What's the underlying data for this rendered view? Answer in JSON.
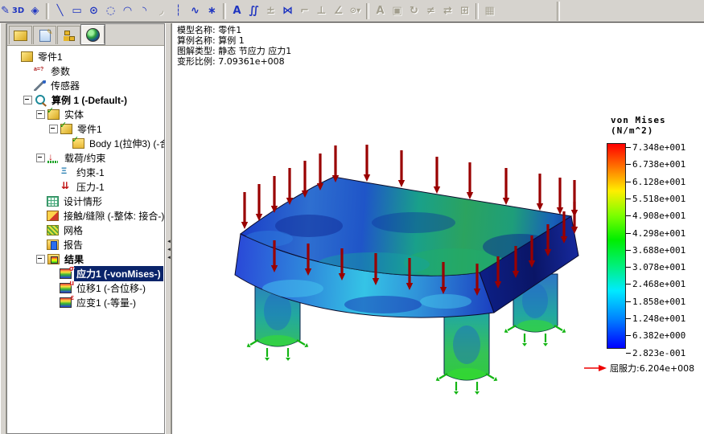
{
  "toolbar": {
    "items": [
      {
        "name": "sketch-icon",
        "glyph": "✎",
        "enabled": true,
        "cut": true
      },
      {
        "name": "sketch-3d-icon",
        "glyph": "3D",
        "enabled": true,
        "small": true
      },
      {
        "name": "modify-sketch-icon",
        "glyph": "◈",
        "enabled": true
      },
      {
        "sep": true
      },
      {
        "name": "line-icon",
        "glyph": "╲",
        "enabled": true
      },
      {
        "name": "rectangle-icon",
        "glyph": "▭",
        "enabled": true
      },
      {
        "name": "circle-icon",
        "glyph": "⊙",
        "enabled": true
      },
      {
        "name": "ellipse-icon",
        "glyph": "◌",
        "enabled": true
      },
      {
        "name": "centerpoint-arc-icon",
        "glyph": "◠",
        "enabled": true
      },
      {
        "name": "tangent-arc-icon",
        "glyph": "◝",
        "enabled": true
      },
      {
        "name": "three-point-arc-icon",
        "glyph": "◞",
        "enabled": false
      },
      {
        "name": "centerline-icon",
        "glyph": "┆",
        "enabled": true
      },
      {
        "name": "spline-icon",
        "glyph": "∿",
        "enabled": true
      },
      {
        "name": "point-icon",
        "glyph": "∗",
        "enabled": true
      },
      {
        "sep": true
      },
      {
        "name": "sketch-text-icon",
        "glyph": "A",
        "enabled": true
      },
      {
        "name": "offset-entities-icon",
        "glyph": "∬",
        "enabled": true
      },
      {
        "name": "convert-entities-icon",
        "glyph": "±",
        "enabled": false
      },
      {
        "name": "mirror-entities-icon",
        "glyph": "⋈",
        "enabled": true
      },
      {
        "name": "sketch-fillet-icon",
        "glyph": "⌐",
        "enabled": false
      },
      {
        "name": "perpendicular-relation-icon",
        "glyph": "⊥",
        "enabled": false
      },
      {
        "name": "dimension-icon",
        "glyph": "∠",
        "enabled": false
      },
      {
        "name": "view-orientation-dropdown-icon",
        "glyph": "⊙▾",
        "enabled": false,
        "small": true
      },
      {
        "sep": true
      },
      {
        "name": "annotation-icon",
        "glyph": "A",
        "enabled": false
      },
      {
        "name": "feature-cube-icon",
        "glyph": "▣",
        "enabled": false
      },
      {
        "name": "sweep-icon",
        "glyph": "↻",
        "enabled": false
      },
      {
        "name": "section-icon",
        "glyph": "≠",
        "enabled": false
      },
      {
        "name": "exchange-icon",
        "glyph": "⇄",
        "enabled": false
      },
      {
        "name": "pattern-icon",
        "glyph": "⊞",
        "enabled": false
      },
      {
        "sep": true
      },
      {
        "name": "picture-icon",
        "glyph": "▦",
        "enabled": false
      }
    ]
  },
  "panel_tabs": [
    {
      "name": "tab-featuremanager",
      "icon": "t-fm",
      "active": false
    },
    {
      "name": "tab-propertymanager",
      "icon": "t-pm",
      "active": false
    },
    {
      "name": "tab-configurationmanager",
      "icon": "t-cm",
      "active": false
    },
    {
      "name": "tab-simulation-manager",
      "icon": "t-sim",
      "active": true
    }
  ],
  "tree": {
    "items": [
      {
        "label": "零件1",
        "icon": "part",
        "level": 0,
        "bold": false
      },
      {
        "label": "参数",
        "icon": "parameters",
        "level": 1
      },
      {
        "label": "传感器",
        "icon": "sensors",
        "level": 1
      },
      {
        "label": "算例 1 (-Default-)",
        "icon": "study",
        "level": 1,
        "bold": true,
        "expand": true
      },
      {
        "label": "实体",
        "icon": "solids",
        "level": 2,
        "expand": true
      },
      {
        "label": "零件1",
        "icon": "solid-part",
        "level": 3,
        "expand": true
      },
      {
        "label": "Body 1(拉伸3) (-合",
        "icon": "body",
        "level": 4
      },
      {
        "label": "载荷/约束",
        "icon": "loads",
        "level": 2,
        "expand": true
      },
      {
        "label": "约束-1",
        "icon": "restraint",
        "level": 3
      },
      {
        "label": "压力-1",
        "icon": "pressure",
        "level": 3
      },
      {
        "label": "设计情形",
        "icon": "design-scenario",
        "level": 2
      },
      {
        "label": "接触/缝隙 (-整体: 接合-)",
        "icon": "contact",
        "level": 2
      },
      {
        "label": "网格",
        "icon": "mesh",
        "level": 2
      },
      {
        "label": "报告",
        "icon": "report",
        "level": 2
      },
      {
        "label": "结果",
        "icon": "results",
        "level": 2,
        "bold": true,
        "expand": true
      },
      {
        "label": "应力1 (-vonMises-)",
        "icon": "stress-plot",
        "level": 3,
        "selected": true
      },
      {
        "label": "位移1 (-合位移-)",
        "icon": "displacement-plot",
        "level": 3
      },
      {
        "label": "应变1 (-等量-)",
        "icon": "strain-plot",
        "level": 3
      }
    ]
  },
  "viewport": {
    "annotation": {
      "lines": {
        "0": "模型名称: 零件1",
        "1": "算例名称: 算例 1",
        "2": "图解类型: 静态 节应力 应力1",
        "3": "变形比例: 7.09361e+008"
      }
    },
    "model": {
      "type": "fea-von-mises-contour-plot",
      "pressure_arrow_color": "#990000",
      "restraint_arrow_color": "#14b514"
    }
  },
  "legend": {
    "title": "von Mises (N/m^2)",
    "labels": [
      "7.348e+001",
      "6.738e+001",
      "6.128e+001",
      "5.518e+001",
      "4.908e+001",
      "4.298e+001",
      "3.688e+001",
      "3.078e+001",
      "2.468e+001",
      "1.858e+001",
      "1.248e+001",
      "6.382e+000",
      "2.823e-001"
    ],
    "gradient": [
      {
        "pos": 0,
        "color": "#ff0000"
      },
      {
        "pos": 0.11,
        "color": "#ff7000"
      },
      {
        "pos": 0.23,
        "color": "#ffee00"
      },
      {
        "pos": 0.35,
        "color": "#7dff00"
      },
      {
        "pos": 0.47,
        "color": "#00ee00"
      },
      {
        "pos": 0.6,
        "color": "#00f07d"
      },
      {
        "pos": 0.72,
        "color": "#00eaff"
      },
      {
        "pos": 0.86,
        "color": "#0080ff"
      },
      {
        "pos": 1,
        "color": "#0000ff"
      }
    ],
    "yield_text": "屈服力:6.204e+008",
    "yield_arrow_color": "#ee0000"
  }
}
